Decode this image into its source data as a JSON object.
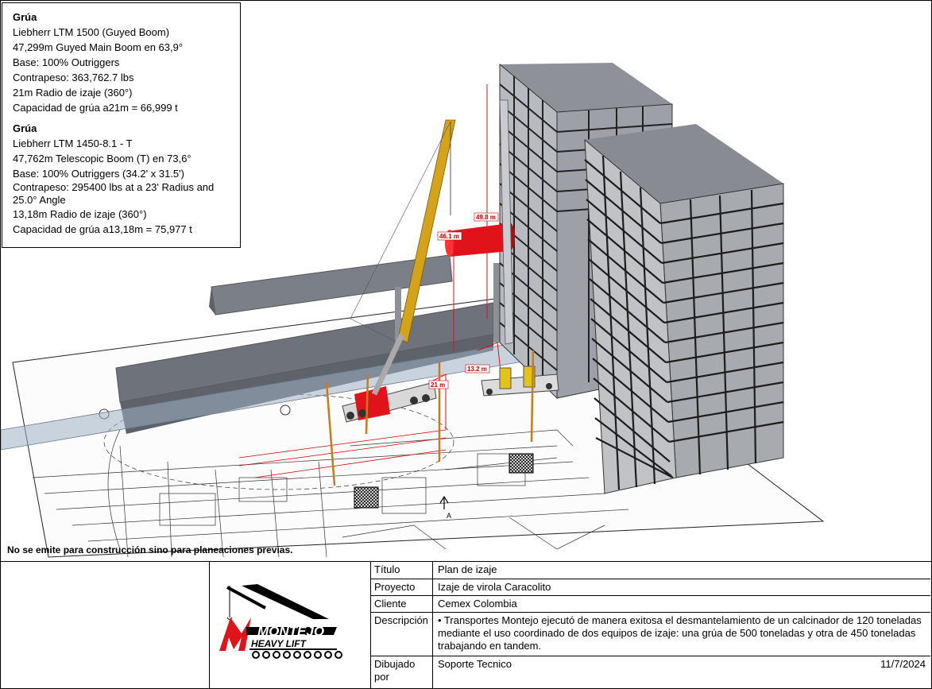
{
  "crane1": {
    "heading": "Grúa",
    "lines": [
      "Liebherr LTM 1500 (Guyed Boom)",
      "47,299m Guyed Main Boom en 63,9°",
      "Base: 100% Outriggers",
      "Contrapeso: 363,762.7 lbs",
      "21m Radio de izaje (360°)",
      "Capacidad de grúa a21m = 66,999 t"
    ]
  },
  "crane2": {
    "heading": "Grúa",
    "lines": [
      "Liebherr LTM 1450-8.1 - T",
      "47,762m Telescopic Boom (T) en 73,6°",
      "Base: 100% Outriggers (34.2' x 31.5')",
      "Contrapeso: 295400 lbs at a 23' Radius and 25.0° Angle",
      "13,18m Radio de izaje (360°)",
      "Capacidad de grúa a13,18m = 75,977 t"
    ]
  },
  "scene": {
    "dim_labels": [
      "49.8 m",
      "46.1 m",
      "13.2 m",
      "21 m"
    ],
    "north_label": "A",
    "colors": {
      "building": "#a3a6ab",
      "load": "#e0121a",
      "boom": "#d4a31a",
      "duct": "#7b8088"
    }
  },
  "disclaimer": "No se emite para construcción sino para planeaciones previas.",
  "logo": {
    "line1": "MONTEJO",
    "line2": "HEAVY LIFT"
  },
  "titleblock": {
    "titulo_label": "Título",
    "titulo_value": "Plan de izaje",
    "proyecto_label": "Proyecto",
    "proyecto_value": "Izaje de virola Caracolito",
    "cliente_label": "Cliente",
    "cliente_value": "Cemex Colombia",
    "descripcion_label": "Descripción",
    "descripcion_value": "• Transportes Montejo ejecutó de manera exitosa el desmantelamiento de un calcinador de 120 toneladas mediante el uso coordinado de dos equipos de izaje: una grúa de 500 toneladas y otra de 450 toneladas trabajando en tandem.",
    "dibujado_label": "Dibujado por",
    "dibujado_value": "Soporte Tecnico",
    "fecha": "11/7/2024"
  }
}
